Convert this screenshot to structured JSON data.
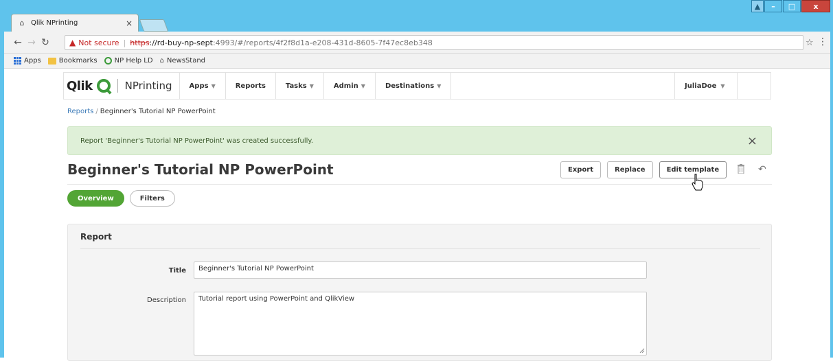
{
  "browser": {
    "tab_title": "Qlik NPrinting",
    "tab_close": "×",
    "not_secure": "Not secure",
    "url_https": "https",
    "url_host": "://rd-buy-np-sept",
    "url_path": ":4993/#/reports/4f2f8d1a-e208-431d-8605-7f47ec8eb348",
    "bookmarks": [
      "Apps",
      "Bookmarks",
      "NP Help LD",
      "NewsStand"
    ],
    "window_buttons": {
      "minimize": "–",
      "maximize": "□",
      "close": "x"
    }
  },
  "nav": {
    "logo_word": "Qlik",
    "product": "NPrinting",
    "items": [
      {
        "label": "Apps",
        "dropdown": true
      },
      {
        "label": "Reports",
        "dropdown": false
      },
      {
        "label": "Tasks",
        "dropdown": true
      },
      {
        "label": "Admin",
        "dropdown": true
      },
      {
        "label": "Destinations",
        "dropdown": true
      }
    ],
    "user": "JuliaDoe",
    "caret": "▼"
  },
  "breadcrumb": {
    "parent": "Reports",
    "separator": "/",
    "current": "Beginner's Tutorial NP PowerPoint"
  },
  "alert": {
    "message": "Report 'Beginner's Tutorial NP PowerPoint' was created successfully.",
    "close": "×"
  },
  "page": {
    "title": "Beginner's Tutorial NP PowerPoint",
    "actions": [
      "Export",
      "Replace",
      "Edit template"
    ]
  },
  "tabs": [
    "Overview",
    "Filters"
  ],
  "report_panel": {
    "heading": "Report",
    "title_label": "Title",
    "title_value": "Beginner's Tutorial NP PowerPoint",
    "description_label": "Description",
    "description_value": "Tutorial report using PowerPoint and QlikView"
  },
  "colors": {
    "accent_green": "#52a535",
    "alert_bg": "#dff0d8",
    "link": "#3b7ab8",
    "window_chrome": "#5fc3ec"
  }
}
